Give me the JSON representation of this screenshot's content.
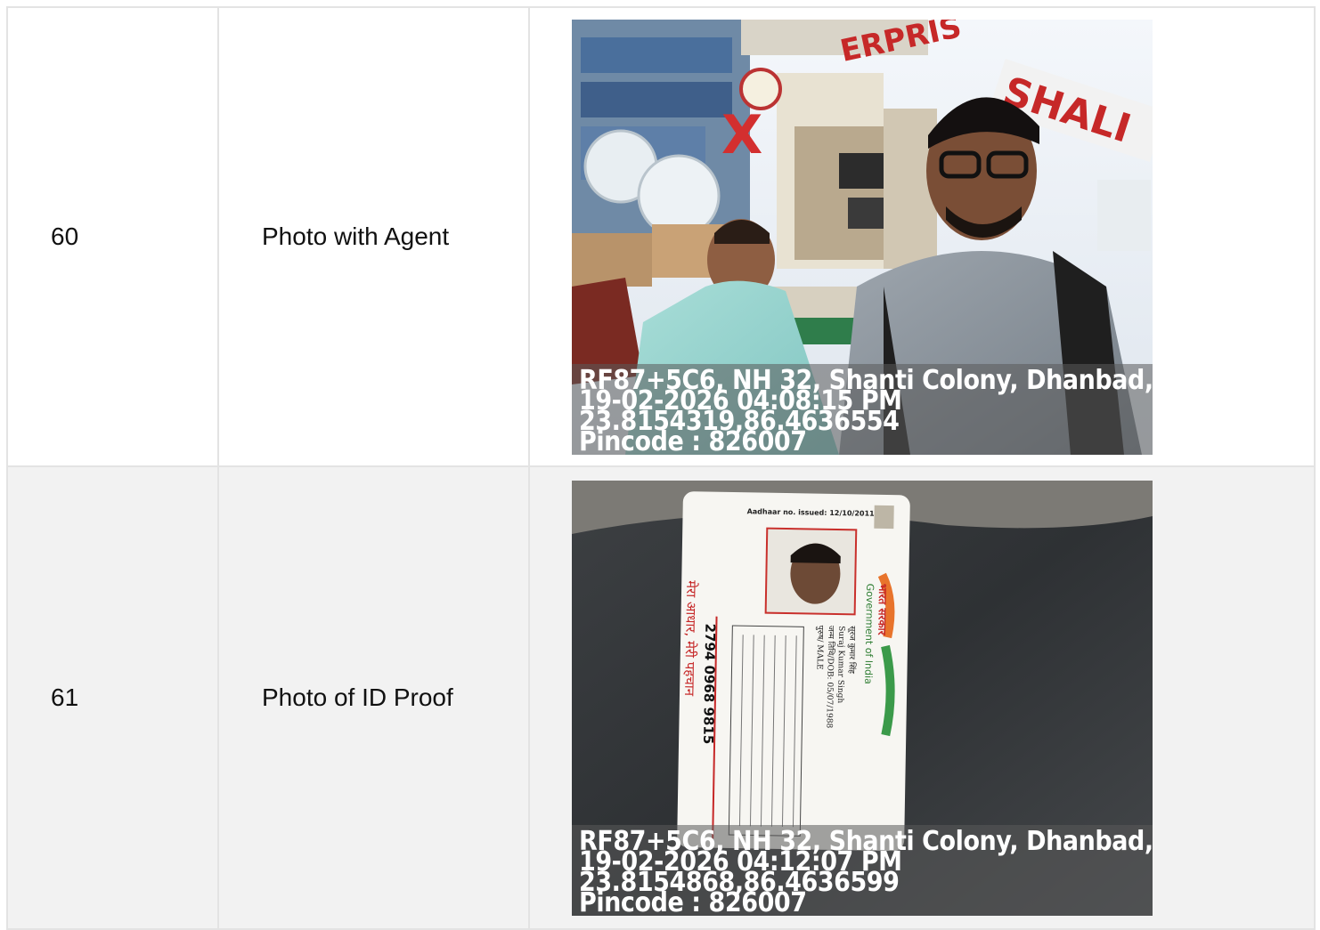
{
  "rows": [
    {
      "number": "60",
      "label": "Photo with Agent",
      "photo_icon": "selfie-photo-shop-front",
      "stamp": {
        "address": "RF87+5C6, NH 32, Shanti Colony, Dhanbad, .",
        "datetime": "19-02-2026 04:08:15 PM",
        "coords": "23.8154319,86.4636554",
        "pincode": "Pincode : 826007"
      },
      "shop_sign": "SHALI",
      "sign_fragment": "ERPRIS"
    },
    {
      "number": "61",
      "label": "Photo of ID Proof",
      "photo_icon": "aadhaar-card-photo",
      "stamp": {
        "address": "RF87+5C6, NH 32, Shanti Colony, Dhanbad, .",
        "datetime": "19-02-2026 04:12:07 PM",
        "coords": "23.8154868,86.4636599",
        "pincode": "Pincode : 826007"
      },
      "card": {
        "issued": "Aadhaar no. issued: 12/10/2011",
        "gov_hindi": "भारत सरकार",
        "gov_english": "Government of India",
        "name_hindi": "सूरज कुमार सिंह",
        "name_english": "Suraj Kumar Singh",
        "dob": "जन्म तिथि/DOB: 05/07/1988",
        "gender": "पुरुष/ MALE",
        "number": "2794 0968 9815",
        "tagline": "मेरा आधार, मेरी पहचान"
      }
    }
  ],
  "colors": {
    "border": "#e3e3e3",
    "row_alt": "#f2f2f2"
  }
}
